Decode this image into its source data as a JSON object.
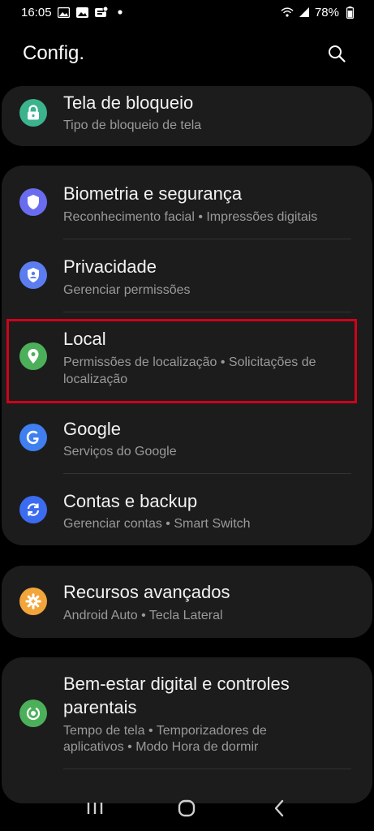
{
  "status_bar": {
    "time": "16:05",
    "battery": "78%",
    "icons_left": [
      "image-icon",
      "image-icon",
      "app-notification-icon",
      "dot-icon"
    ],
    "icons_right": [
      "wifi-icon",
      "signal-icon",
      "battery-icon"
    ]
  },
  "header": {
    "title": "Config.",
    "search_icon": "search-icon"
  },
  "settings": {
    "lock_screen": {
      "title": "Tela de bloqueio",
      "subtitle": "Tipo de bloqueio de tela",
      "icon": "lock-icon",
      "color": "#3bb38c"
    },
    "biometrics": {
      "title": "Biometria e segurança",
      "subtitle": "Reconhecimento facial  •  Impressões digitais",
      "icon": "shield-icon",
      "color": "#6a6cf0"
    },
    "privacy": {
      "title": "Privacidade",
      "subtitle": "Gerenciar permissões",
      "icon": "privacy-shield-icon",
      "color": "#5b7df0"
    },
    "location": {
      "title": "Local",
      "subtitle_line1": "Permissões de localização  •  Solicitações de",
      "subtitle_line2": "localização",
      "icon": "location-pin-icon",
      "color": "#4cb05a"
    },
    "google": {
      "title": "Google",
      "subtitle": "Serviços do Google",
      "icon": "google-icon",
      "color": "#3f7ff0"
    },
    "accounts": {
      "title": "Contas e backup",
      "subtitle": "Gerenciar contas  •  Smart Switch",
      "icon": "sync-icon",
      "color": "#3b6cf0"
    },
    "advanced": {
      "title": "Recursos avançados",
      "subtitle": "Android Auto  •  Tecla Lateral",
      "icon": "gear-plus-icon",
      "color": "#f2a53a"
    },
    "wellbeing": {
      "title_line1": "Bem-estar digital e controles",
      "title_line2": "parentais",
      "subtitle_line1": "Tempo de tela  •  Temporizadores de",
      "subtitle_line2": "aplicativos  •  Modo Hora de dormir",
      "icon": "wellbeing-icon",
      "color": "#4cb05a"
    }
  },
  "highlight_color": "#d0021b",
  "nav": {
    "recents_icon": "recents-icon",
    "home_icon": "home-icon",
    "back_icon": "back-icon"
  }
}
